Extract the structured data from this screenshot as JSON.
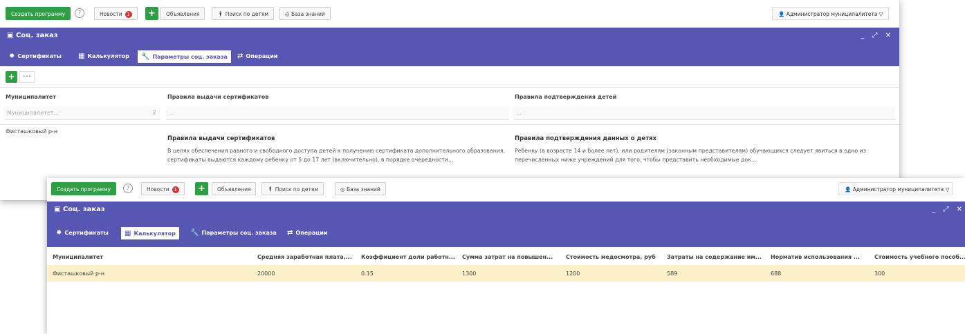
{
  "topbar": {
    "create_program": "Создать программу",
    "help": "?",
    "news": "Новости",
    "news_count": "1",
    "plus": "+",
    "announcements": "Объявления",
    "search_children": "Поиск по детям",
    "knowledge_base": "База знаний",
    "user": "Администратор муниципалитета"
  },
  "window": {
    "title": "Соц. заказ",
    "controls": "_ ⤢ ✕"
  },
  "tabs": {
    "certificates": "Сертификаты",
    "calculator": "Калькулятор",
    "params": "Параметры соц. заказа",
    "operations": "Операции"
  },
  "params_table": {
    "add": "+",
    "more": "•••",
    "columns": [
      "Муниципалитет",
      "Правила выдачи сертификатов",
      "Правила подтверждения детей"
    ],
    "filters": [
      "Муниципалитет...",
      "...",
      "..."
    ],
    "row": {
      "municipality": "Фисташковый р-н",
      "cert_rules_title": "Правила выдачи сертификатов",
      "cert_rules_text": "В целях обеспечения равного и свободного доступа детей к получению сертификата дополнительного образования, сертификаты выдаются каждому ребенку от 5 до 17 лет (включительно), в порядке очередности...",
      "child_rules_title": "Правила подтверждения данных о детях",
      "child_rules_text": "Ребенку (в возрасте 14 и более лет), или родителям (законным представителям) обучающихся следует явиться в одно из перечисленных ниже учреждений для того, чтобы представить необходимые док..."
    }
  },
  "calc_table": {
    "columns": [
      "Муниципалитет",
      "Средняя заработная плата,...",
      "Коэффициент доли работн...",
      "Сумма затрат на повышен...",
      "Стоимость медосмотра, руб",
      "Затраты на содержание им...",
      "Норматив использования ...",
      "Стоимость учебного пособ..."
    ],
    "row": [
      "Фисташковый р-н",
      "20000",
      "0.15",
      "1300",
      "1200",
      "589",
      "688",
      "300"
    ]
  },
  "colors": {
    "accent": "#5656b3",
    "green": "#2f9e44",
    "badge": "#e03131",
    "row_highlight": "#fdf1c9"
  }
}
